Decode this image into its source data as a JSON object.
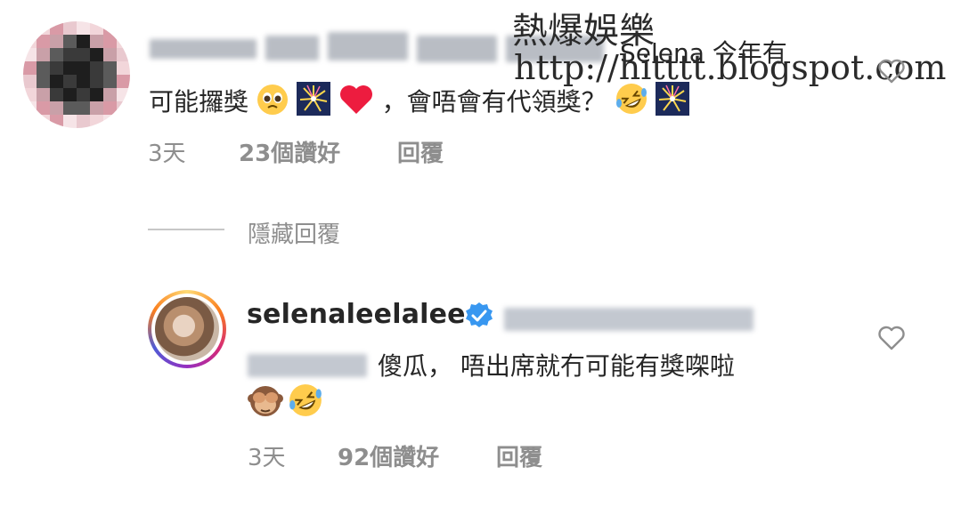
{
  "watermark": {
    "title": "熱爆娛樂",
    "url": "http://hitttt.blogspot.com"
  },
  "comment": {
    "username_suffix": "Selena 今年有",
    "line2_text_a": "可能攞獎",
    "line2_text_b": "，會唔會有代領獎？",
    "time": "3天",
    "likes": "23個讚好",
    "reply": "回覆"
  },
  "hidden_replies": {
    "label": "隱藏回覆"
  },
  "reply": {
    "username": "selenaleelalee",
    "verified_icon": "verified-badge-icon",
    "text": "傻瓜， 唔出席就冇可能有獎㗎啦",
    "time": "3天",
    "likes": "92個讚好",
    "reply": "回覆"
  },
  "icons": {
    "like": "heart-outline-icon",
    "pleading": "pleading-face-emoji",
    "fireworks": "fireworks-emoji",
    "heart": "red-heart-emoji",
    "laughing": "rolling-laughing-emoji",
    "monkey": "see-no-evil-monkey-emoji"
  },
  "colors": {
    "text": "#262626",
    "meta": "#8e8e8e",
    "verified": "#3897f0",
    "heart_red": "#ed1c3f"
  }
}
